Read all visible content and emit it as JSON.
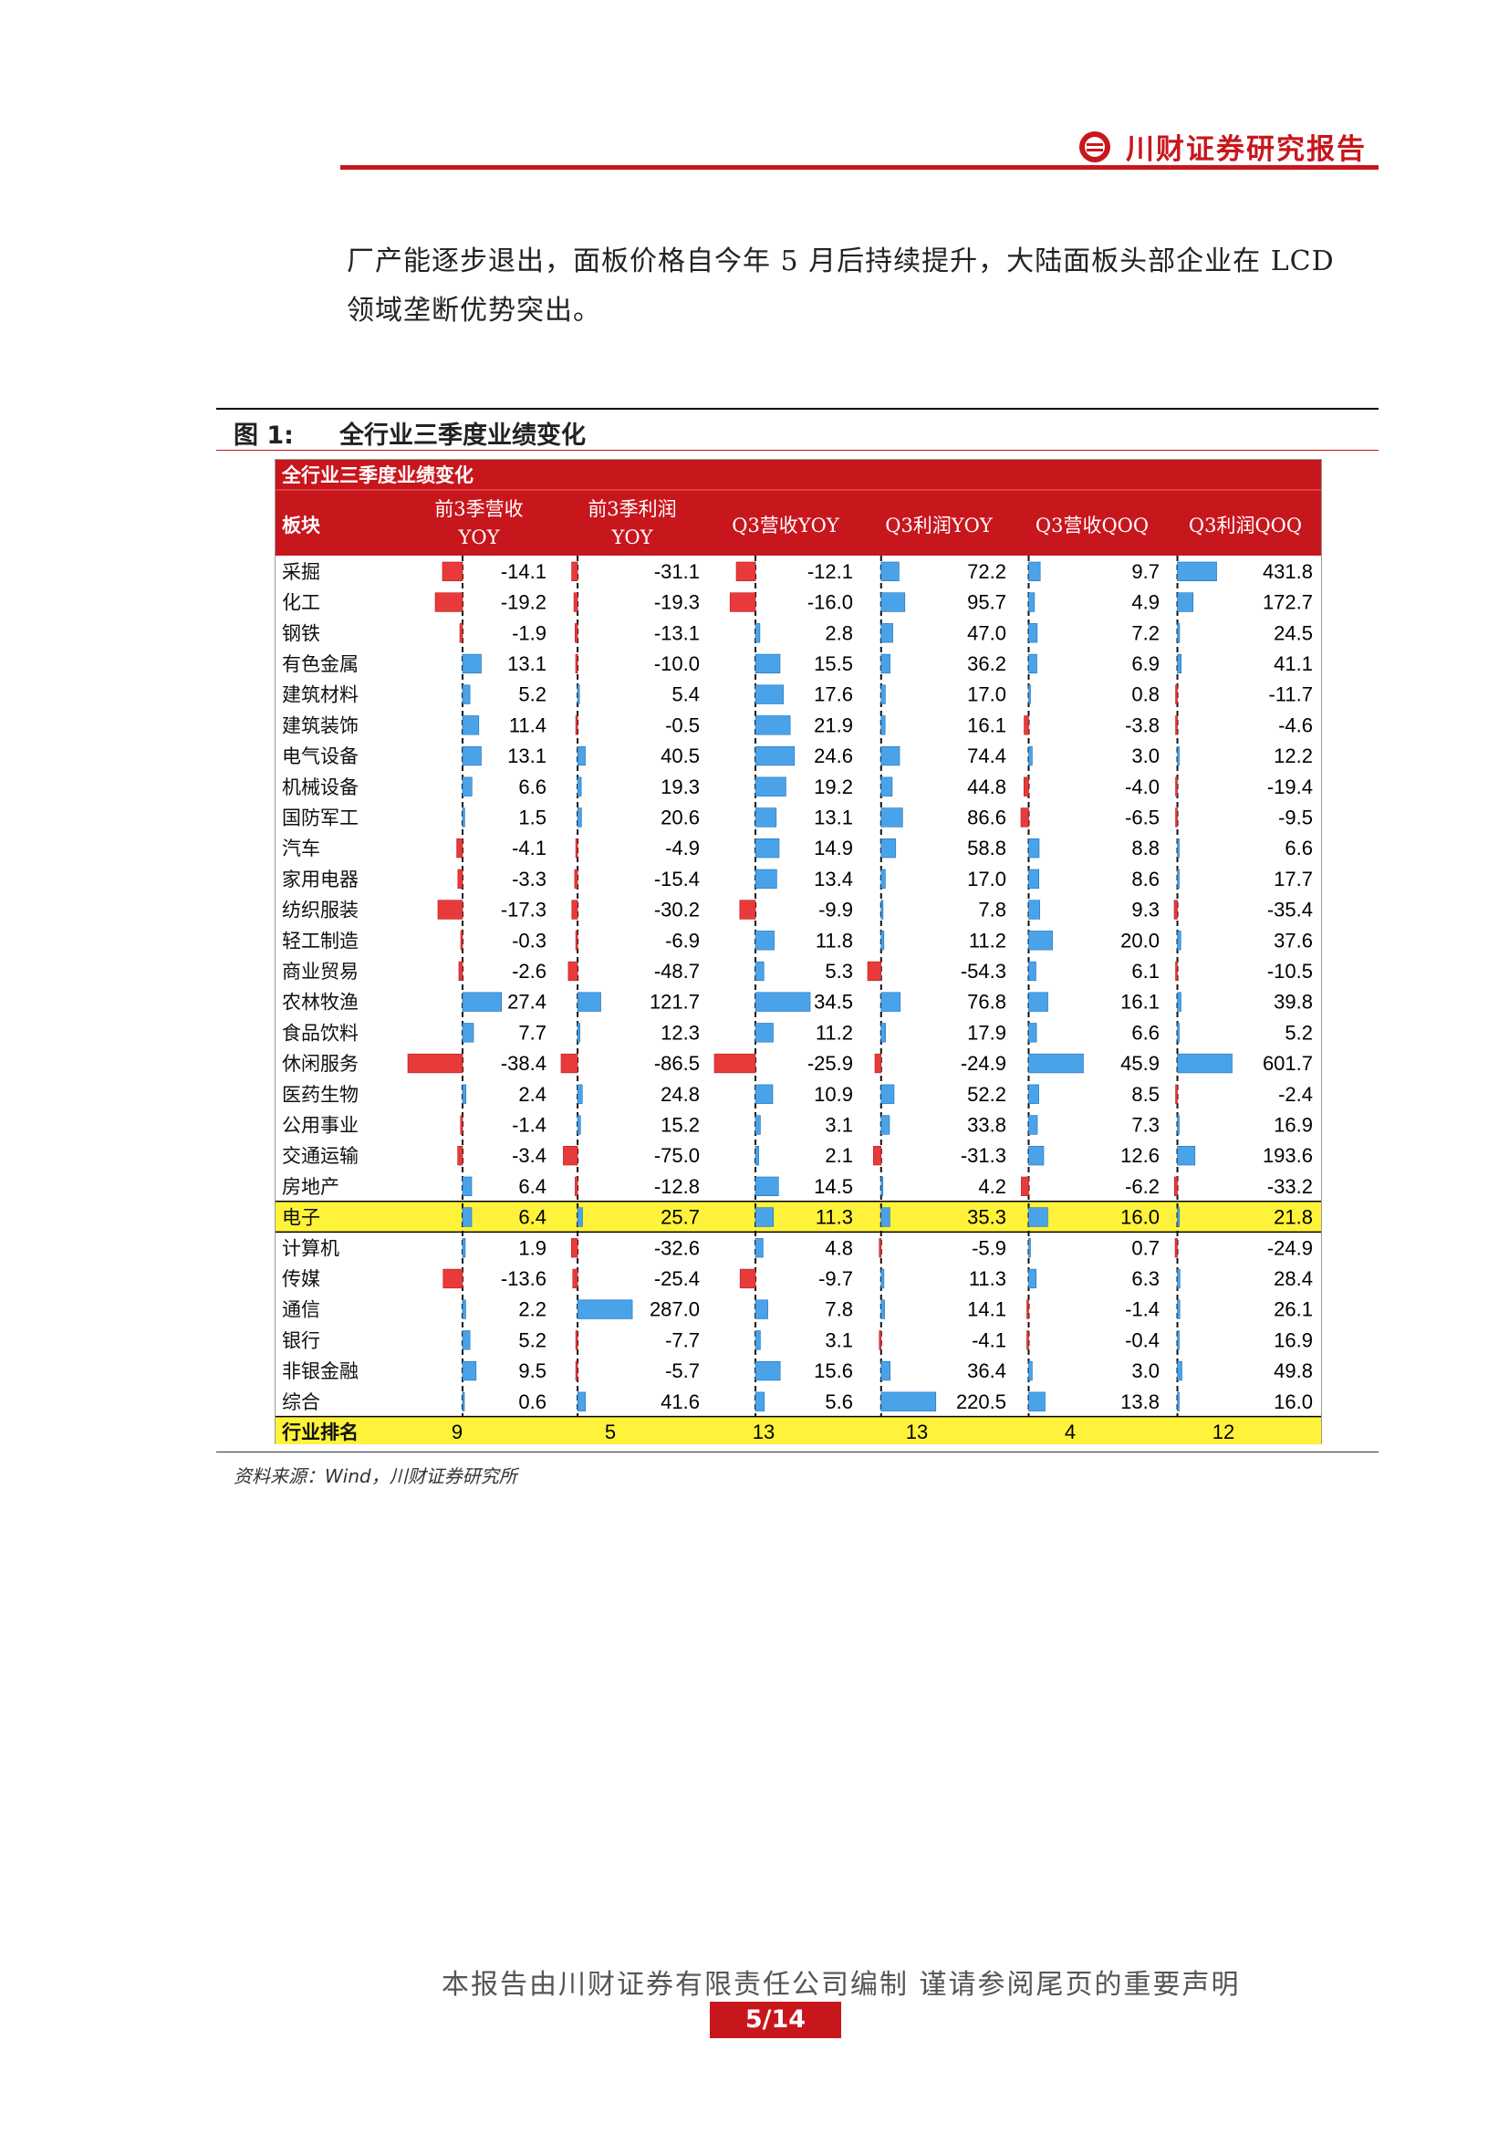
{
  "header": {
    "brand": "川财证券研究报告"
  },
  "paragraph": {
    "line1": "厂产能逐步退出，面板价格自今年 5 月后持续提升，大陆面板头部企业在 LCD",
    "line2": "领域垄断优势突出。"
  },
  "figure": {
    "label": "图 1:",
    "title": "全行业三季度业绩变化"
  },
  "colors": {
    "accent": "#c8161d",
    "bar_positive": "#4aa3e8",
    "bar_negative": "#e83a3a",
    "highlight": "#fff23a"
  },
  "chart_data": {
    "type": "table",
    "title": "全行业三季度业绩变化",
    "row_header": "板块",
    "columns": [
      {
        "line1": "前3季营收",
        "line2": "YOY"
      },
      {
        "line1": "前3季利润",
        "line2": "YOY"
      },
      {
        "line1": "Q3营收YOY",
        "line2": ""
      },
      {
        "line1": "Q3利润YOY",
        "line2": ""
      },
      {
        "line1": "Q3营收QOQ",
        "line2": ""
      },
      {
        "line1": "Q3利润QOQ",
        "line2": ""
      }
    ],
    "rows": [
      {
        "name": "采掘",
        "values": [
          -14.1,
          -31.1,
          -12.1,
          72.2,
          9.7,
          431.8
        ]
      },
      {
        "name": "化工",
        "values": [
          -19.2,
          -19.3,
          -16.0,
          95.7,
          4.9,
          172.7
        ]
      },
      {
        "name": "钢铁",
        "values": [
          -1.9,
          -13.1,
          2.8,
          47.0,
          7.2,
          24.5
        ]
      },
      {
        "name": "有色金属",
        "values": [
          13.1,
          -10.0,
          15.5,
          36.2,
          6.9,
          41.1
        ]
      },
      {
        "name": "建筑材料",
        "values": [
          5.2,
          5.4,
          17.6,
          17.0,
          0.8,
          -11.7
        ]
      },
      {
        "name": "建筑装饰",
        "values": [
          11.4,
          -0.5,
          21.9,
          16.1,
          -3.8,
          -4.6
        ]
      },
      {
        "name": "电气设备",
        "values": [
          13.1,
          40.5,
          24.6,
          74.4,
          3.0,
          12.2
        ]
      },
      {
        "name": "机械设备",
        "values": [
          6.6,
          19.3,
          19.2,
          44.8,
          -4.0,
          -19.4
        ]
      },
      {
        "name": "国防军工",
        "values": [
          1.5,
          20.6,
          13.1,
          86.6,
          -6.5,
          -9.5
        ]
      },
      {
        "name": "汽车",
        "values": [
          -4.1,
          -4.9,
          14.9,
          58.8,
          8.8,
          6.6
        ]
      },
      {
        "name": "家用电器",
        "values": [
          -3.3,
          -15.4,
          13.4,
          17.0,
          8.6,
          17.7
        ]
      },
      {
        "name": "纺织服装",
        "values": [
          -17.3,
          -30.2,
          -9.9,
          7.8,
          9.3,
          -35.4
        ]
      },
      {
        "name": "轻工制造",
        "values": [
          -0.3,
          -6.9,
          11.8,
          11.2,
          20.0,
          37.6
        ]
      },
      {
        "name": "商业贸易",
        "values": [
          -2.6,
          -48.7,
          5.3,
          -54.3,
          6.1,
          -10.5
        ]
      },
      {
        "name": "农林牧渔",
        "values": [
          27.4,
          121.7,
          34.5,
          76.8,
          16.1,
          39.8
        ]
      },
      {
        "name": "食品饮料",
        "values": [
          7.7,
          12.3,
          11.2,
          17.9,
          6.6,
          5.2
        ]
      },
      {
        "name": "休闲服务",
        "values": [
          -38.4,
          -86.5,
          -25.9,
          -24.9,
          45.9,
          601.7
        ]
      },
      {
        "name": "医药生物",
        "values": [
          2.4,
          24.8,
          10.9,
          52.2,
          8.5,
          -2.4
        ]
      },
      {
        "name": "公用事业",
        "values": [
          -1.4,
          15.2,
          3.1,
          33.8,
          7.3,
          16.9
        ]
      },
      {
        "name": "交通运输",
        "values": [
          -3.4,
          -75.0,
          2.1,
          -31.3,
          12.6,
          193.6
        ]
      },
      {
        "name": "房地产",
        "values": [
          6.4,
          -12.8,
          14.5,
          4.2,
          -6.2,
          -33.2
        ]
      },
      {
        "name": "电子",
        "values": [
          6.4,
          25.7,
          11.3,
          35.3,
          16.0,
          21.8
        ],
        "highlight": true
      },
      {
        "name": "计算机",
        "values": [
          1.9,
          -32.6,
          4.8,
          -5.9,
          0.7,
          -24.9
        ]
      },
      {
        "name": "传媒",
        "values": [
          -13.6,
          -25.4,
          -9.7,
          11.3,
          6.3,
          28.4
        ]
      },
      {
        "name": "通信",
        "values": [
          2.2,
          287.0,
          7.8,
          14.1,
          -1.4,
          26.1
        ]
      },
      {
        "name": "银行",
        "values": [
          5.2,
          -7.7,
          3.1,
          -4.1,
          -0.4,
          16.9
        ]
      },
      {
        "name": "非银金融",
        "values": [
          9.5,
          -5.7,
          15.6,
          36.4,
          3.0,
          49.8
        ]
      },
      {
        "name": "综合",
        "values": [
          0.6,
          41.6,
          5.6,
          220.5,
          13.8,
          16.0
        ]
      }
    ],
    "rank_label": "行业排名",
    "ranks": [
      "9",
      "5",
      "13",
      "13",
      "4",
      "12"
    ]
  },
  "source": "资料来源：Wind，川财证券研究所",
  "footer": {
    "note": "本报告由川财证券有限责任公司编制  谨请参阅尾页的重要声明",
    "page": "5/14"
  }
}
